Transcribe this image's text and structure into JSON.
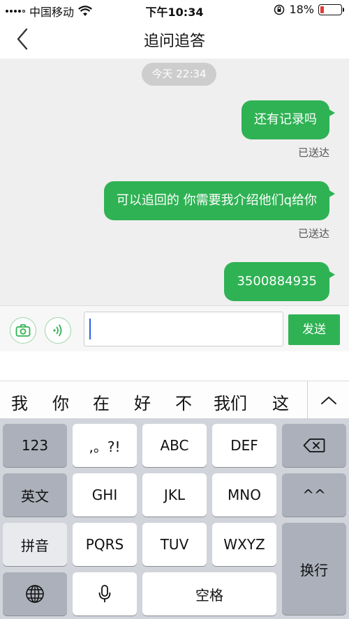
{
  "status_bar": {
    "carrier": "中国移动",
    "time": "下午10:34",
    "battery": "18%",
    "battery_level": 0.18
  },
  "nav": {
    "title": "追问追答"
  },
  "chat": {
    "timestamp": "今天 22:34",
    "messages": [
      {
        "text": "还有记录吗",
        "status": "已送达"
      },
      {
        "text": "可以追回的 你需要我介绍他们q给你",
        "status": "已送达"
      },
      {
        "text": "3500884935"
      }
    ]
  },
  "input": {
    "value": "",
    "send_label": "发送"
  },
  "candidates": [
    "我",
    "你",
    "在",
    "好",
    "不",
    "我们",
    "这"
  ],
  "keyboard": {
    "row1": [
      "123",
      ",。?!",
      "ABC",
      "DEF"
    ],
    "row2": [
      "英文",
      "GHI",
      "JKL",
      "MNO",
      "^^"
    ],
    "row3": [
      "拼音",
      "PQRS",
      "TUV",
      "WXYZ"
    ],
    "enter": "换行",
    "space": "空格"
  },
  "colors": {
    "accent": "#2fb254",
    "battery_low": "#e53935"
  },
  "icons": [
    "back-chevron-icon",
    "camera-icon",
    "voice-icon",
    "backspace-icon",
    "globe-icon",
    "microphone-icon",
    "collapse-icon",
    "wifi-icon",
    "rotation-lock-icon"
  ]
}
